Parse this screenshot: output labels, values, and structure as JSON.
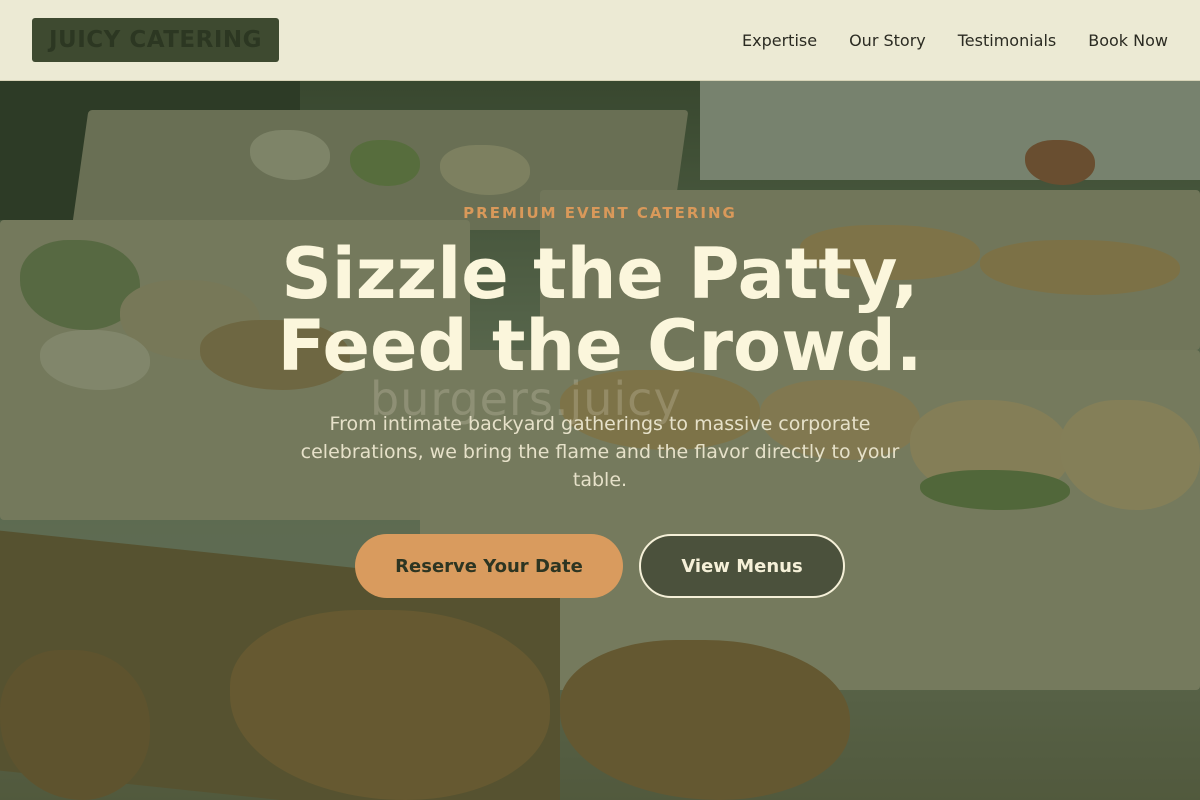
{
  "header": {
    "logo_text": "JUICY CATERING",
    "nav": [
      {
        "label": "Expertise"
      },
      {
        "label": "Our Story"
      },
      {
        "label": "Testimonials"
      },
      {
        "label": "Book Now"
      }
    ]
  },
  "hero": {
    "eyebrow": "PREMIUM EVENT CATERING",
    "headline_line1": "Sizzle the Patty,",
    "headline_line2": "Feed the Crowd.",
    "background_watermark": "burgers.juicy",
    "subtitle": "From intimate backyard gatherings to massive corporate celebrations, we bring the flame and the flavor directly to your table.",
    "primary_cta": "Reserve Your Date",
    "secondary_cta": "View Menus"
  },
  "colors": {
    "header_bg": "#ecead4",
    "logo_bg": "#3e4a30",
    "accent": "#d99b5e",
    "headline": "#fbf6dc",
    "overlay": "#3c4e32"
  },
  "icons": []
}
